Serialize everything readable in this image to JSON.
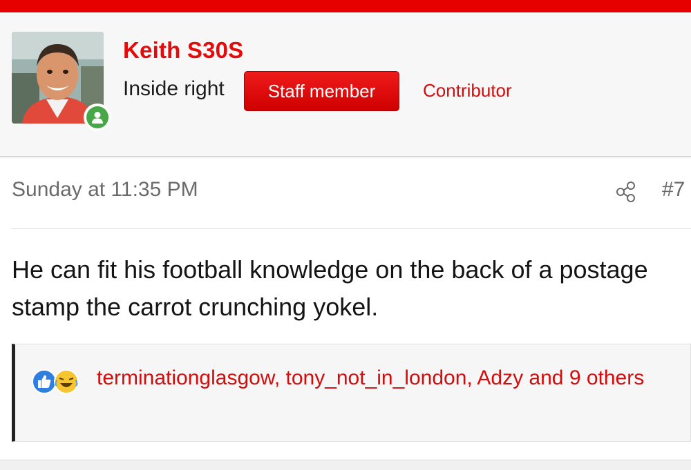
{
  "user": {
    "name": "Keith S30S",
    "title": "Inside right",
    "banner": "Staff member",
    "role": "Contributor",
    "online": true
  },
  "post": {
    "date": "Sunday at 11:35 PM",
    "number": "#7",
    "message": "He can fit his football knowledge on the back of a postage stamp the carrot crunching yokel."
  },
  "reactions": {
    "icons": [
      "like-icon",
      "laugh-icon"
    ],
    "text": "terminationglasgow, tony_not_in_london, Adzy and 9 others"
  },
  "colors": {
    "brand_red": "#e60000",
    "link_red": "#d10d0d",
    "online_green": "#47a747"
  }
}
